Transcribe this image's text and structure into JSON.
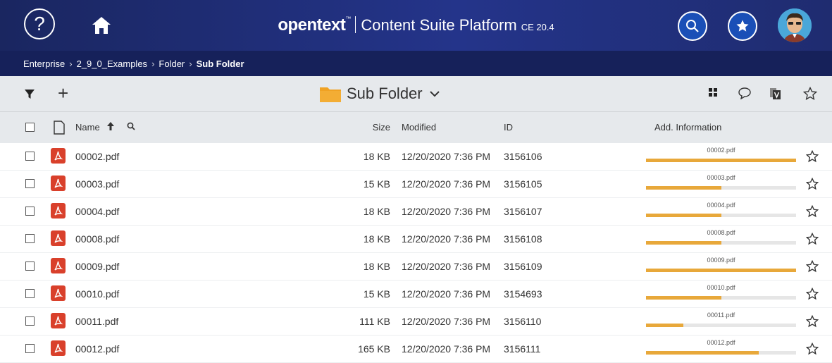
{
  "header": {
    "help_glyph": "?",
    "logo": "opentext",
    "logo_tm": "™",
    "product": "Content Suite Platform",
    "version": "CE 20.4",
    "icons": [
      "help-icon",
      "home-icon",
      "search-icon",
      "star-icon",
      "avatar"
    ]
  },
  "breadcrumb": {
    "items": [
      "Enterprise",
      "2_9_0_Examples",
      "Folder",
      "Sub Folder"
    ],
    "separator": "›"
  },
  "toolbar": {
    "title": "Sub Folder",
    "add_glyph": "+",
    "icons": [
      "filter-icon",
      "add-icon",
      "folder-icon",
      "chevron-down-icon",
      "grid-view-icon",
      "comment-icon",
      "version-icon",
      "star-icon"
    ]
  },
  "columns": {
    "name": "Name",
    "size": "Size",
    "modified": "Modified",
    "id": "ID",
    "add_info": "Add. Information"
  },
  "rows": [
    {
      "name": "00002.pdf",
      "size": "18 KB",
      "modified": "12/20/2020 7:36 PM",
      "id": "3156106",
      "info": "00002.pdf",
      "progress": 1.0
    },
    {
      "name": "00003.pdf",
      "size": "15 KB",
      "modified": "12/20/2020 7:36 PM",
      "id": "3156105",
      "info": "00003.pdf",
      "progress": 0.5
    },
    {
      "name": "00004.pdf",
      "size": "18 KB",
      "modified": "12/20/2020 7:36 PM",
      "id": "3156107",
      "info": "00004.pdf",
      "progress": 0.5
    },
    {
      "name": "00008.pdf",
      "size": "18 KB",
      "modified": "12/20/2020 7:36 PM",
      "id": "3156108",
      "info": "00008.pdf",
      "progress": 0.5
    },
    {
      "name": "00009.pdf",
      "size": "18 KB",
      "modified": "12/20/2020 7:36 PM",
      "id": "3156109",
      "info": "00009.pdf",
      "progress": 1.0
    },
    {
      "name": "00010.pdf",
      "size": "15 KB",
      "modified": "12/20/2020 7:36 PM",
      "id": "3154693",
      "info": "00010.pdf",
      "progress": 0.5
    },
    {
      "name": "00011.pdf",
      "size": "111 KB",
      "modified": "12/20/2020 7:36 PM",
      "id": "3156110",
      "info": "00011.pdf",
      "progress": 0.25
    },
    {
      "name": "00012.pdf",
      "size": "165 KB",
      "modified": "12/20/2020 7:36 PM",
      "id": "3156111",
      "info": "00012.pdf",
      "progress": 0.75
    }
  ],
  "colors": {
    "header_bg": "#1f2c70",
    "breadcrumb_bg": "#16215a",
    "toolbar_bg": "#e6e9ec",
    "accent": "#1a4fb7",
    "progress": "#e8a83a",
    "pdf": "#d9402b",
    "folder": "#f0a223"
  }
}
